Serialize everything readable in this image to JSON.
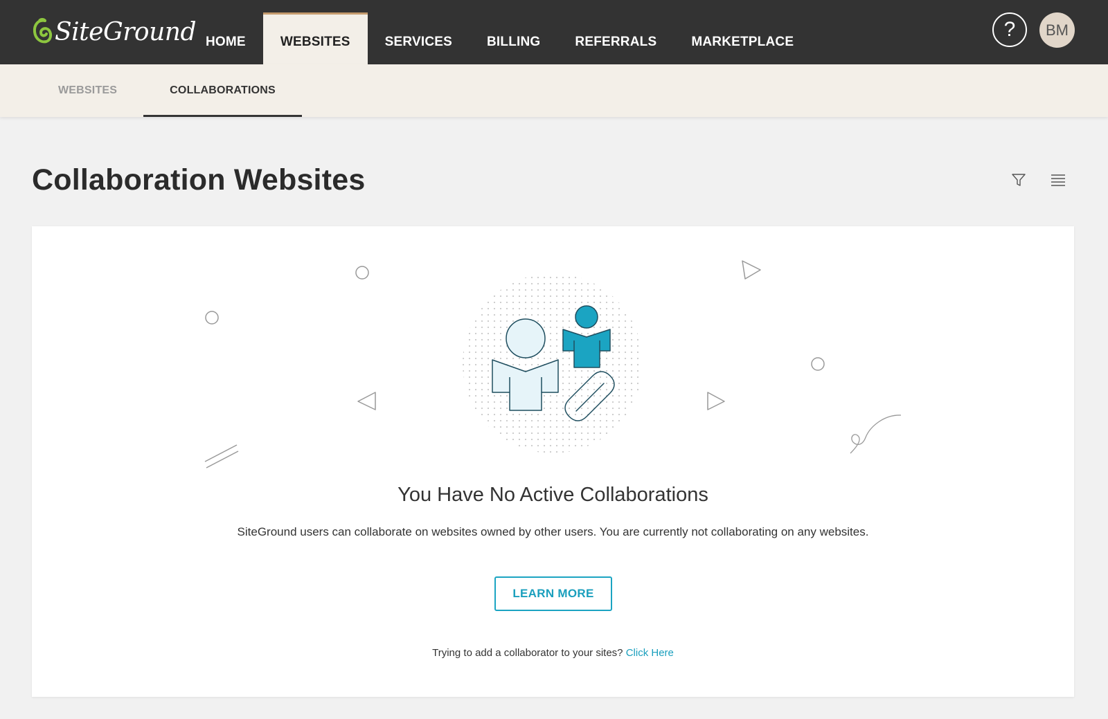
{
  "brand": {
    "logo_text": "SiteGround",
    "accent": "#8dc63f"
  },
  "main_nav": {
    "items": [
      {
        "label": "HOME"
      },
      {
        "label": "WEBSITES"
      },
      {
        "label": "SERVICES"
      },
      {
        "label": "BILLING"
      },
      {
        "label": "REFERRALS"
      },
      {
        "label": "MARKETPLACE"
      }
    ],
    "active": "WEBSITES"
  },
  "header": {
    "help_label": "?",
    "avatar_initials": "BM"
  },
  "sub_nav": {
    "items": [
      {
        "label": "WEBSITES"
      },
      {
        "label": "COLLABORATIONS"
      }
    ],
    "active": "COLLABORATIONS"
  },
  "page": {
    "title": "Collaboration Websites",
    "toolbar_icons": [
      "filter-icon",
      "list-icon"
    ]
  },
  "empty_state": {
    "title": "You Have No Active Collaborations",
    "description": "SiteGround users can collaborate on websites owned by other users. You are currently not collaborating on any websites.",
    "button_label": "LEARN MORE",
    "footer_text": "Trying to add a collaborator to your sites?",
    "footer_link": "Click Here"
  },
  "colors": {
    "topbar": "#333333",
    "subbar": "#f3efe8",
    "teal": "#1ba4c2",
    "light_blue": "#e6f4f9"
  }
}
